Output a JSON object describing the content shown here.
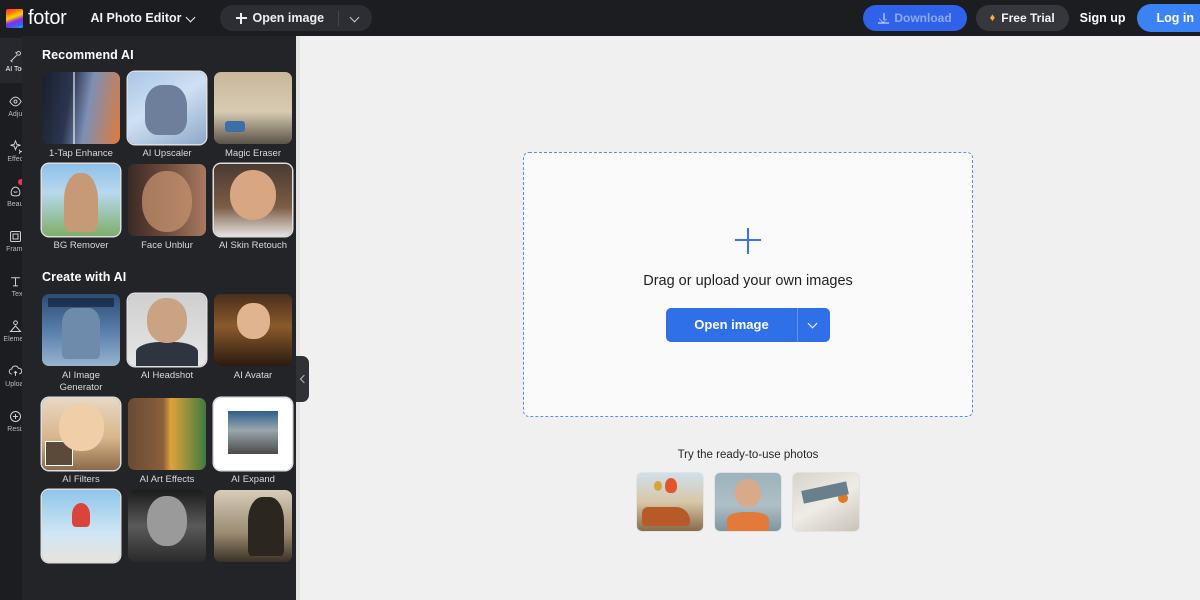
{
  "header": {
    "logo_text": "fotor",
    "logo_icon": "fotor-logo-icon",
    "mode_label": "AI Photo Editor",
    "mode_caret_icon": "chevron-down-icon",
    "open_image_label": "Open image",
    "open_image_plus_icon": "plus-icon",
    "open_image_caret_icon": "chevron-down-icon",
    "download_label": "Download",
    "download_icon": "download-icon",
    "free_trial_label": "Free Trial",
    "free_trial_icon": "crown-icon",
    "sign_up_label": "Sign up",
    "log_in_label": "Log in"
  },
  "rail": {
    "items": [
      {
        "label": "AI Tools",
        "icon": "ai-tools-icon",
        "active": true,
        "dot": false
      },
      {
        "label": "Adjust",
        "icon": "adjust-icon",
        "active": false,
        "dot": false
      },
      {
        "label": "Effects",
        "icon": "effects-icon",
        "active": false,
        "dot": false
      },
      {
        "label": "Beauty",
        "icon": "beauty-icon",
        "active": false,
        "dot": true
      },
      {
        "label": "Frames",
        "icon": "frames-icon",
        "active": false,
        "dot": false
      },
      {
        "label": "Text",
        "icon": "text-icon",
        "active": false,
        "dot": false
      },
      {
        "label": "Elements",
        "icon": "elements-icon",
        "active": false,
        "dot": false
      },
      {
        "label": "Uploads",
        "icon": "uploads-icon",
        "active": false,
        "dot": false
      },
      {
        "label": "Resize",
        "icon": "resize-icon",
        "active": false,
        "dot": false
      }
    ]
  },
  "panel": {
    "collapse_icon": "chevron-left-icon",
    "sections": [
      {
        "title": "Recommend AI",
        "cards": [
          {
            "label": "1-Tap Enhance",
            "art": "a-enhance",
            "ring": false,
            "checker": false
          },
          {
            "label": "AI Upscaler",
            "art": "a-upscaler",
            "ring": true,
            "checker": false
          },
          {
            "label": "Magic Eraser",
            "art": "a-eraser",
            "ring": false,
            "checker": false
          },
          {
            "label": "BG Remover",
            "art": "a-bg",
            "ring": true,
            "checker": true
          },
          {
            "label": "Face Unblur",
            "art": "a-unblur",
            "ring": false,
            "checker": false
          },
          {
            "label": "AI Skin Retouch",
            "art": "a-skin",
            "ring": true,
            "checker": false
          }
        ]
      },
      {
        "title": "Create with AI",
        "cards": [
          {
            "label": "AI Image Generator",
            "art": "a-imggen",
            "ring": false,
            "checker": false
          },
          {
            "label": "AI Headshot",
            "art": "a-headshot",
            "ring": true,
            "checker": false
          },
          {
            "label": "AI Avatar",
            "art": "a-avatar",
            "ring": false,
            "checker": false
          },
          {
            "label": "AI Filters",
            "art": "a-filters",
            "ring": true,
            "checker": false
          },
          {
            "label": "AI Art Effects",
            "art": "a-art",
            "ring": false,
            "checker": false
          },
          {
            "label": "AI Expand",
            "art": "a-expand",
            "ring": true,
            "checker": true
          },
          {
            "label": "",
            "art": "a-ice",
            "ring": true,
            "checker": false
          },
          {
            "label": "",
            "art": "a-bw",
            "ring": false,
            "checker": false
          },
          {
            "label": "",
            "art": "a-vintage",
            "ring": false,
            "checker": false
          }
        ]
      }
    ]
  },
  "canvas": {
    "dropzone": {
      "plus_icon": "plus-icon",
      "text": "Drag or upload your own images",
      "open_button_label": "Open image",
      "open_button_caret_icon": "chevron-down-icon"
    },
    "ready": {
      "title": "Try the ready-to-use photos",
      "thumbs": [
        {
          "name": "hot-air-balloons-car-photo",
          "art": "r-car"
        },
        {
          "name": "portrait-woman-photo",
          "art": "r-woman"
        },
        {
          "name": "flatlay-desk-photo",
          "art": "r-flat"
        }
      ]
    }
  },
  "colors": {
    "header_bg": "#1c1d21",
    "panel_bg": "#232428",
    "canvas_bg": "#f0f0f0",
    "accent_blue": "#2f6fe8",
    "login_blue": "#3b82f6",
    "dash_blue": "#5b8cf5",
    "notification_red": "#f0325a",
    "crown_gold": "#f5b23c"
  }
}
